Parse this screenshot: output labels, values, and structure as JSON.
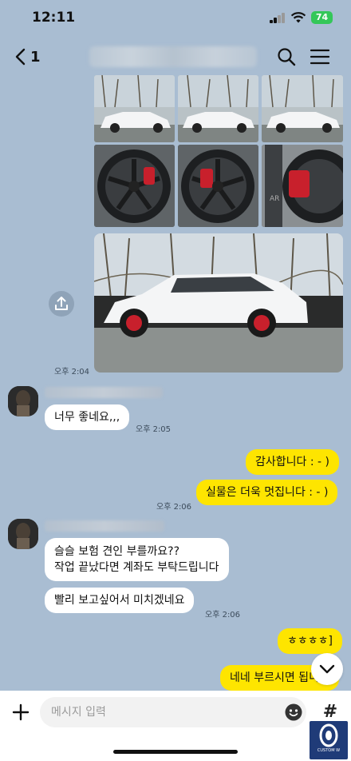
{
  "status": {
    "time": "12:11",
    "battery": "74"
  },
  "header": {
    "back_count": "1"
  },
  "messages": {
    "photo_time": "오후 2:04",
    "in1_text": "너무 좋네요,,,",
    "in1_time": "오후 2:05",
    "out1_text": "감사합니다 : - )",
    "out2_text": "실물은 더욱 멋집니다 : - )",
    "out2_time": "오후 2:06",
    "in2_line1": "슬슬 보험 견인 부를까요??",
    "in2_line2": "작업 끝났다면 계좌도 부탁드립니다",
    "in3_text": "빨리 보고싶어서 미치겠네요",
    "in3_time": "오후 2:06",
    "out3_text": "ㅎㅎㅎㅎ]",
    "out4_text": "네네 부르시면 됩니다"
  },
  "input": {
    "placeholder": "메시지 입력"
  },
  "logo": {
    "text": "CUSTOM W"
  }
}
